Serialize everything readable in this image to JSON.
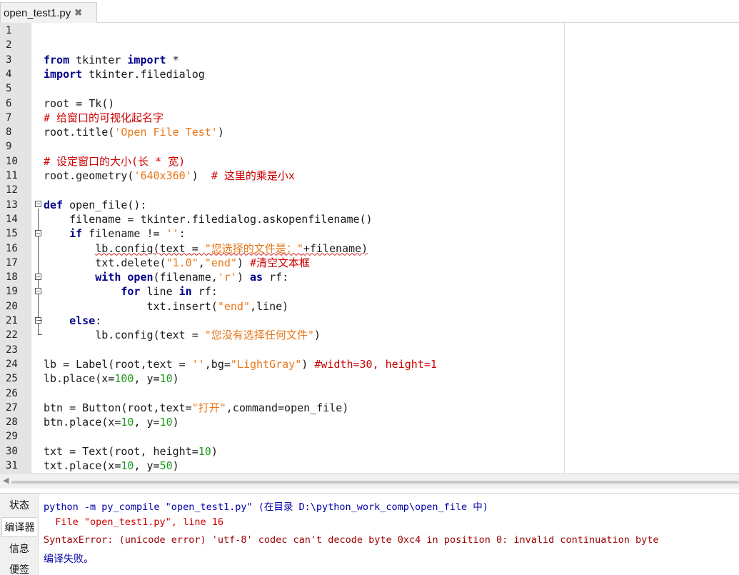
{
  "tab": {
    "filename": "open_test1.py",
    "close_glyph": "✖"
  },
  "editor": {
    "lines": [
      {
        "n": "1",
        "parts": []
      },
      {
        "n": "2",
        "parts": []
      },
      {
        "n": "3",
        "parts": [
          {
            "t": "from",
            "c": "kw"
          },
          {
            "t": " tkinter "
          },
          {
            "t": "import",
            "c": "kw"
          },
          {
            "t": " *"
          }
        ]
      },
      {
        "n": "4",
        "parts": [
          {
            "t": "import",
            "c": "kw"
          },
          {
            "t": " tkinter.filedialog"
          }
        ]
      },
      {
        "n": "5",
        "parts": []
      },
      {
        "n": "6",
        "parts": [
          {
            "t": "root = Tk()"
          }
        ]
      },
      {
        "n": "7",
        "parts": [
          {
            "t": "# 给窗口的可视化起名字",
            "c": "cm"
          }
        ]
      },
      {
        "n": "8",
        "parts": [
          {
            "t": "root.title("
          },
          {
            "t": "'Open File Test'",
            "c": "str"
          },
          {
            "t": ")"
          }
        ]
      },
      {
        "n": "9",
        "parts": []
      },
      {
        "n": "10",
        "parts": [
          {
            "t": "# 设定窗口的大小(长 * 宽)",
            "c": "cm"
          }
        ]
      },
      {
        "n": "11",
        "parts": [
          {
            "t": "root.geometry("
          },
          {
            "t": "'640x360'",
            "c": "str"
          },
          {
            "t": ")  "
          },
          {
            "t": "# 这里的乘是小x",
            "c": "cm"
          }
        ]
      },
      {
        "n": "12",
        "parts": []
      },
      {
        "n": "13",
        "parts": [
          {
            "t": "def",
            "c": "kw"
          },
          {
            "t": " open_file():"
          }
        ]
      },
      {
        "n": "14",
        "parts": [
          {
            "t": "    filename = tkinter.filedialog.askopenfilename()"
          }
        ]
      },
      {
        "n": "15",
        "parts": [
          {
            "t": "    "
          },
          {
            "t": "if",
            "c": "kw"
          },
          {
            "t": " filename != "
          },
          {
            "t": "''",
            "c": "str"
          },
          {
            "t": ":"
          }
        ]
      },
      {
        "n": "16",
        "parts": [
          {
            "t": "        "
          },
          {
            "t": "lb.config(text = ",
            "c": "sq"
          },
          {
            "t": "\"您选择的文件是：\"",
            "c": "str sq"
          },
          {
            "t": "+filename)",
            "c": "sq"
          }
        ]
      },
      {
        "n": "17",
        "parts": [
          {
            "t": "        txt.delete("
          },
          {
            "t": "\"1.0\"",
            "c": "str"
          },
          {
            "t": ","
          },
          {
            "t": "\"end\"",
            "c": "str"
          },
          {
            "t": ") "
          },
          {
            "t": "#清空文本框",
            "c": "cm"
          }
        ]
      },
      {
        "n": "18",
        "parts": [
          {
            "t": "        "
          },
          {
            "t": "with",
            "c": "kw"
          },
          {
            "t": " "
          },
          {
            "t": "open",
            "c": "kw"
          },
          {
            "t": "(filename,"
          },
          {
            "t": "'r'",
            "c": "str"
          },
          {
            "t": ") "
          },
          {
            "t": "as",
            "c": "kw"
          },
          {
            "t": " rf:"
          }
        ]
      },
      {
        "n": "19",
        "parts": [
          {
            "t": "            "
          },
          {
            "t": "for",
            "c": "kw"
          },
          {
            "t": " line "
          },
          {
            "t": "in",
            "c": "kw"
          },
          {
            "t": " rf:"
          }
        ]
      },
      {
        "n": "20",
        "parts": [
          {
            "t": "                txt.insert("
          },
          {
            "t": "\"end\"",
            "c": "str"
          },
          {
            "t": ",line)"
          }
        ]
      },
      {
        "n": "21",
        "parts": [
          {
            "t": "    "
          },
          {
            "t": "else",
            "c": "kw"
          },
          {
            "t": ":"
          }
        ]
      },
      {
        "n": "22",
        "parts": [
          {
            "t": "        lb.config(text = "
          },
          {
            "t": "\"您没有选择任何文件\"",
            "c": "str"
          },
          {
            "t": ")"
          }
        ]
      },
      {
        "n": "23",
        "parts": []
      },
      {
        "n": "24",
        "parts": [
          {
            "t": "lb = Label(root,text = "
          },
          {
            "t": "''",
            "c": "str"
          },
          {
            "t": ",bg="
          },
          {
            "t": "\"LightGray\"",
            "c": "str"
          },
          {
            "t": ") "
          },
          {
            "t": "#width=30, height=1",
            "c": "cm"
          }
        ]
      },
      {
        "n": "25",
        "parts": [
          {
            "t": "lb.place(x="
          },
          {
            "t": "100",
            "c": "num"
          },
          {
            "t": ", y="
          },
          {
            "t": "10",
            "c": "num"
          },
          {
            "t": ")"
          }
        ]
      },
      {
        "n": "26",
        "parts": []
      },
      {
        "n": "27",
        "parts": [
          {
            "t": "btn = Button(root,text="
          },
          {
            "t": "\"打开\"",
            "c": "str"
          },
          {
            "t": ",command=open_file)"
          }
        ]
      },
      {
        "n": "28",
        "parts": [
          {
            "t": "btn.place(x="
          },
          {
            "t": "10",
            "c": "num"
          },
          {
            "t": ", y="
          },
          {
            "t": "10",
            "c": "num"
          },
          {
            "t": ")"
          }
        ]
      },
      {
        "n": "29",
        "parts": []
      },
      {
        "n": "30",
        "parts": [
          {
            "t": "txt = Text(root, height="
          },
          {
            "t": "10",
            "c": "num"
          },
          {
            "t": ")"
          }
        ]
      },
      {
        "n": "31",
        "parts": [
          {
            "t": "txt.place(x="
          },
          {
            "t": "10",
            "c": "num"
          },
          {
            "t": ", y="
          },
          {
            "t": "50",
            "c": "num"
          },
          {
            "t": ")"
          }
        ]
      }
    ]
  },
  "panel": {
    "tabs": [
      "状态",
      "编译器",
      "信息",
      "便签"
    ],
    "active_tab": "编译器",
    "output": [
      {
        "text": "python -m py_compile \"open_test1.py\" (在目录 D:\\python_work_comp\\open_file 中)",
        "c": "blue"
      },
      {
        "text": "  File \"open_test1.py\", line 16",
        "c": "red"
      },
      {
        "text": "SyntaxError: (unicode error) 'utf-8' codec can't decode byte 0xc4 in position 0: invalid continuation byte",
        "c": "maroon"
      },
      {
        "text": "编译失败。",
        "c": "blue"
      }
    ]
  },
  "colors": {
    "keyword": "#00008b",
    "string": "#e8771a",
    "comment": "#cc0000",
    "number": "#1a9a1a"
  }
}
